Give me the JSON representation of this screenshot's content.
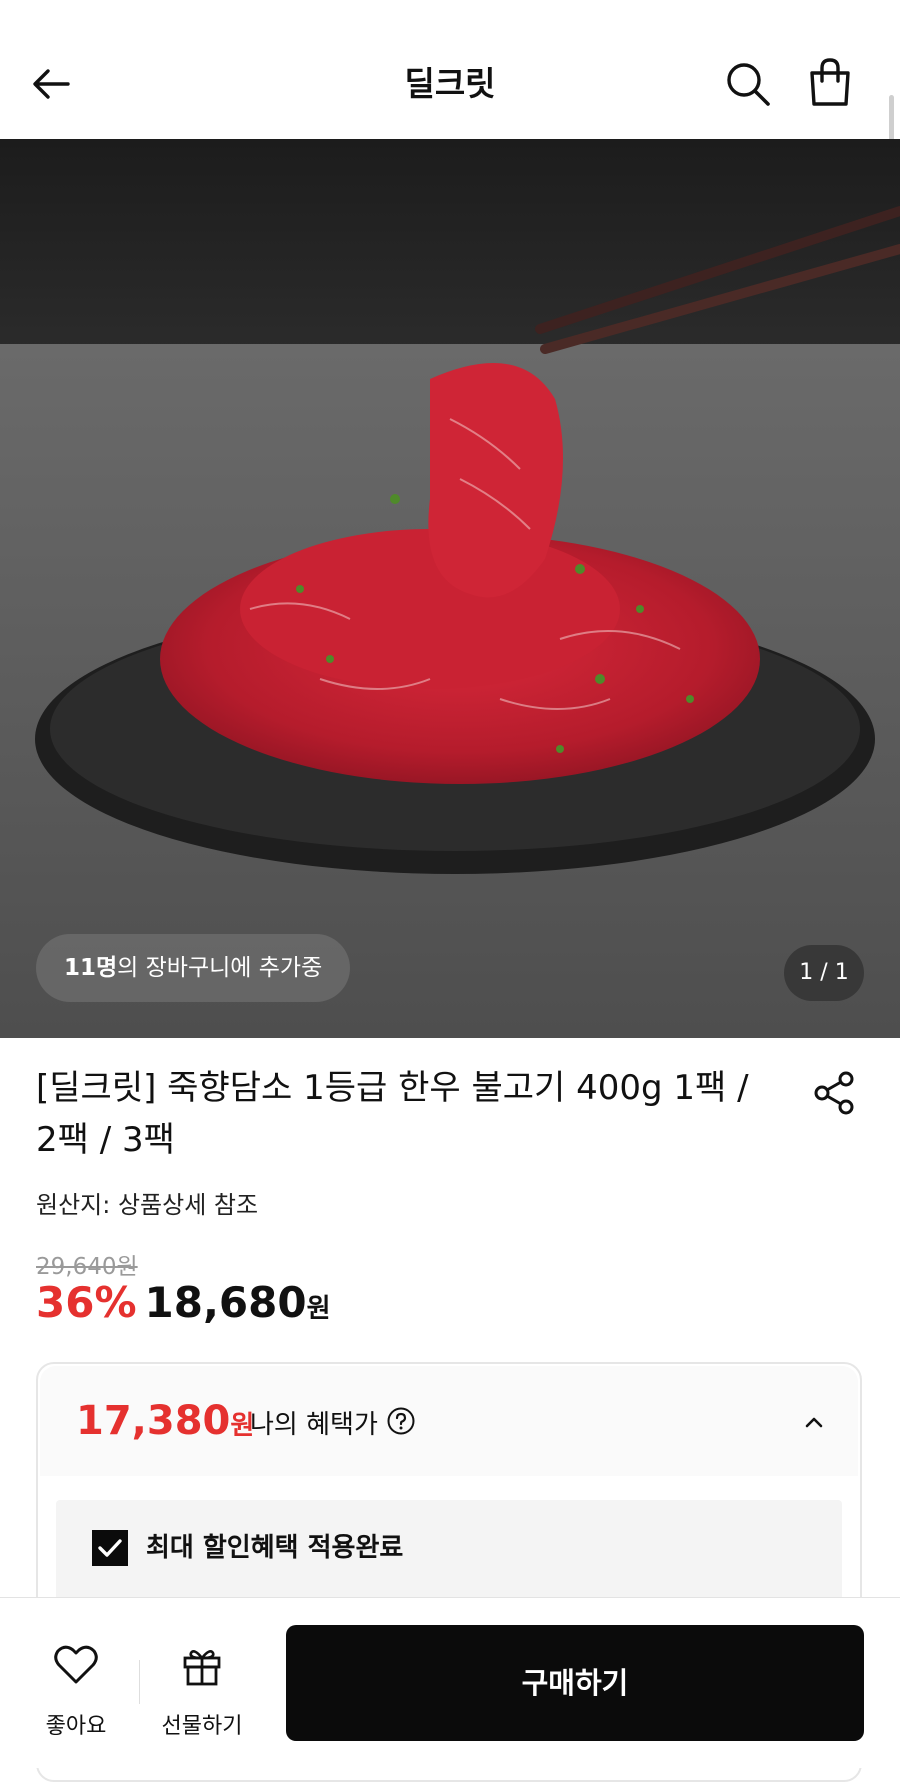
{
  "header": {
    "title": "딜크릿",
    "back_icon": "arrow-left-icon",
    "search_icon": "search-icon",
    "cart_icon": "shopping-bag-icon"
  },
  "hero": {
    "image_description": "bulgogi-beef-photo",
    "cart_count": "11명",
    "cart_text": "의 장바구니에 추가중",
    "counter": "1 / 1"
  },
  "product": {
    "title": "[딜크릿] 죽향담소 1등급 한우 불고기 400g 1팩 / 2팩 / 3팩",
    "origin": "원산지: 상품상세 참조",
    "original_price": "29,640원",
    "discount_rate": "36%",
    "sale_price": "18,680",
    "currency": "원",
    "share_icon": "share-icon"
  },
  "benefit": {
    "price": "17,380",
    "currency": "원",
    "label": "나의 혜택가",
    "help_icon": "question-circle-icon",
    "chevron_icon": "chevron-up-icon",
    "applied_label": "최대 할인혜택 적용완료",
    "applied_checked": true
  },
  "bottom_bar": {
    "like_label": "좋아요",
    "gift_label": "선물하기",
    "buy_label": "구매하기"
  },
  "colors": {
    "accent_red": "#e5312f",
    "buy_button": "#0b0b0b"
  }
}
